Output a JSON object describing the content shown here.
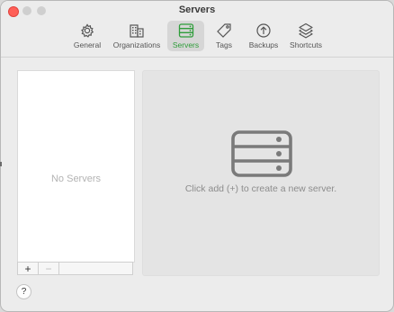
{
  "window": {
    "title": "Servers"
  },
  "toolbar": {
    "items": [
      {
        "label": "General",
        "icon": "gear-icon"
      },
      {
        "label": "Organizations",
        "icon": "building-icon"
      },
      {
        "label": "Servers",
        "icon": "server-icon",
        "active": true
      },
      {
        "label": "Tags",
        "icon": "tag-icon"
      },
      {
        "label": "Backups",
        "icon": "upload-circle-icon"
      },
      {
        "label": "Shortcuts",
        "icon": "layers-icon"
      }
    ],
    "active_color": "#2e9d3a"
  },
  "servers_list": {
    "empty_text": "No Servers",
    "add_label": "+",
    "remove_label": "−"
  },
  "detail": {
    "empty_text": "Click add (+) to create a new server."
  },
  "help": {
    "label": "?"
  }
}
